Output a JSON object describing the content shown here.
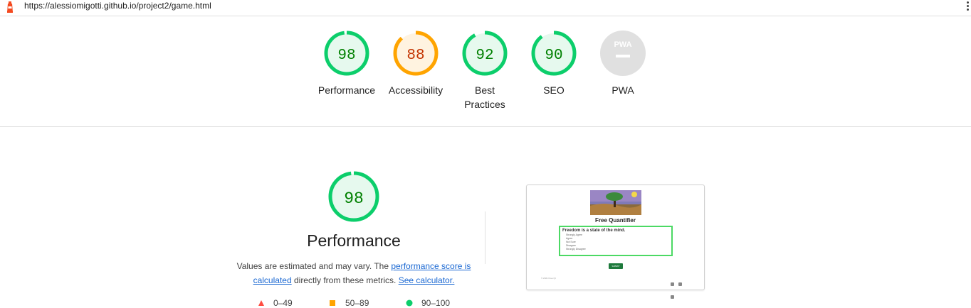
{
  "topbar": {
    "logo_icon": "lighthouse-icon",
    "url": "https://alessiomigotti.github.io/project2/game.html",
    "menu_icon": "kebab-menu-icon"
  },
  "gauges": [
    {
      "label": "Performance",
      "score": "98",
      "value": 98,
      "color": "#0cce6b",
      "text_color": "#008000",
      "fill": "#e6f9ee"
    },
    {
      "label": "Accessibility",
      "score": "88",
      "value": 88,
      "color": "#ffa400",
      "text_color": "#c33300",
      "fill": "#fff3e0"
    },
    {
      "label": "Best Practices",
      "score": "92",
      "value": 92,
      "color": "#0cce6b",
      "text_color": "#008000",
      "fill": "#e6f9ee"
    },
    {
      "label": "SEO",
      "score": "90",
      "value": 90,
      "color": "#0cce6b",
      "text_color": "#008000",
      "fill": "#e6f9ee"
    },
    {
      "label": "PWA",
      "score": "",
      "badge": "PWA",
      "color": "#e0e0e0"
    }
  ],
  "performance": {
    "score": "98",
    "value": 98,
    "title": "Performance",
    "desc_prefix": "Values are estimated and may vary. The ",
    "desc_link1": "performance score is calculated",
    "desc_middle": " directly from these metrics. ",
    "desc_link2": "See calculator."
  },
  "legend": [
    {
      "range": "0–49",
      "shape": "triangle",
      "color": "#ff4e42"
    },
    {
      "range": "50–89",
      "shape": "square",
      "color": "#ffa400"
    },
    {
      "range": "90–100",
      "shape": "circle",
      "color": "#0cce6b"
    }
  ],
  "preview": {
    "title": "Free Quantifier",
    "question": "Freedom is a state of the mind.",
    "options": [
      "Strongly Agree",
      "Agree",
      "Not Sure",
      "Disagree",
      "Strongly Disagree"
    ],
    "submit": "SUBMIT",
    "footer": "© 2021 Free Qt"
  }
}
